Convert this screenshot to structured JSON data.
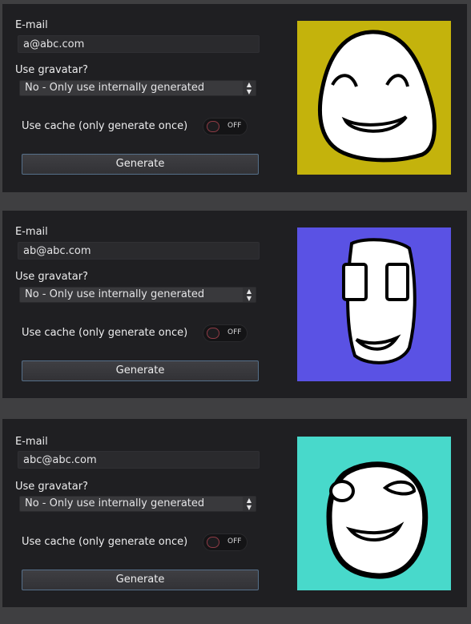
{
  "panels": [
    {
      "email_label": "E-mail",
      "email_value": "a@abc.com",
      "gravatar_label": "Use gravatar?",
      "gravatar_selected": "No - Only use internally generated",
      "cache_label": "Use cache (only generate once)",
      "cache_toggle": "OFF",
      "generate_label": "Generate",
      "avatar_bg": "#c4b30c"
    },
    {
      "email_label": "E-mail",
      "email_value": "ab@abc.com",
      "gravatar_label": "Use gravatar?",
      "gravatar_selected": "No - Only use internally generated",
      "cache_label": "Use cache (only generate once)",
      "cache_toggle": "OFF",
      "generate_label": "Generate",
      "avatar_bg": "#5a52e4"
    },
    {
      "email_label": "E-mail",
      "email_value": "abc@abc.com",
      "gravatar_label": "Use gravatar?",
      "gravatar_selected": "No - Only use internally generated",
      "cache_label": "Use cache (only generate once)",
      "cache_toggle": "OFF",
      "generate_label": "Generate",
      "avatar_bg": "#48d9cb"
    }
  ]
}
